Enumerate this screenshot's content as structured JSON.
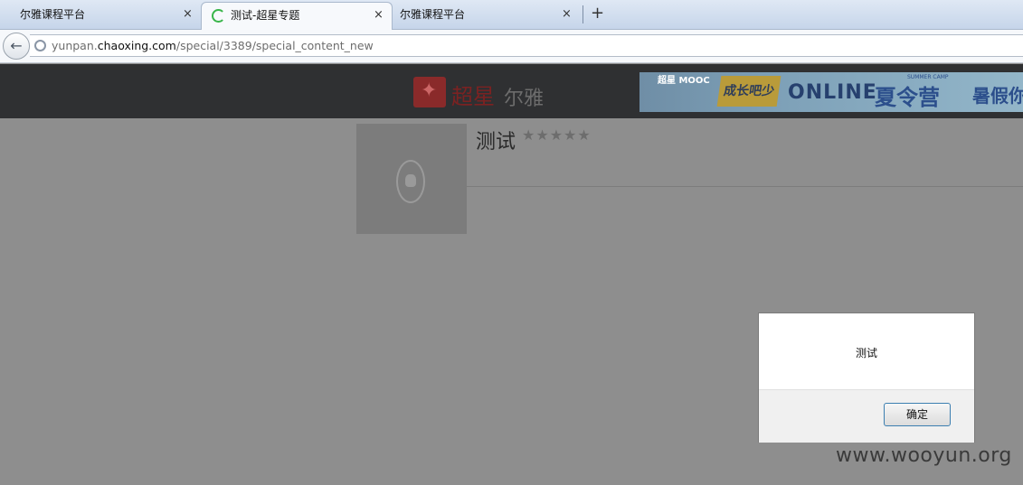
{
  "browser": {
    "tabs": [
      {
        "label": "尔雅课程平台",
        "close": "×"
      },
      {
        "label": "测试-超星专题",
        "close": "×"
      },
      {
        "label": "尔雅课程平台",
        "close": "×"
      }
    ],
    "new_tab": "+",
    "back": "←",
    "url_prefix": "yunpan.",
    "url_domain": "chaoxing.com",
    "url_path": "/special/3389/special_content_new"
  },
  "header": {
    "logo_text": "超星",
    "logo_sub": "尔雅",
    "banner": {
      "mooc": "超星 MOOC",
      "young": "成长吧少年",
      "online": "ONLINE",
      "summer_camp_label": "SUMMER CAMP",
      "summer": "夏令营",
      "holiday": "暑假你"
    }
  },
  "content": {
    "title": "测试",
    "stars": "★★★★★",
    "rating": 0
  },
  "dialog": {
    "message": "测试",
    "ok_label": "确定"
  },
  "watermark": "www.wooyun.org"
}
